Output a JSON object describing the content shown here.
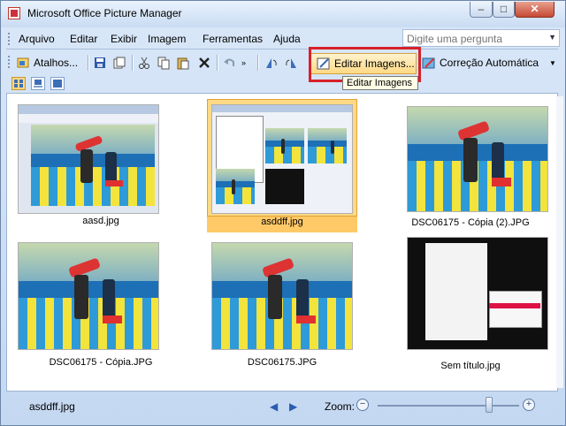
{
  "window": {
    "title": "Microsoft Office Picture Manager"
  },
  "menu": {
    "items": [
      "Arquivo",
      "Editar",
      "Exibir",
      "Imagem",
      "Ferramentas",
      "Ajuda"
    ],
    "help_placeholder": "Digite uma pergunta"
  },
  "toolbar": {
    "shortcuts_label": "Atalhos...",
    "edit_images_label": "Editar Imagens...",
    "auto_correct_label": "Correção Automática",
    "tooltip": "Editar Imagens"
  },
  "thumbnails": [
    {
      "label": "aasd.jpg",
      "kind": "screenshot",
      "selected": false
    },
    {
      "label": "asddff.jpg",
      "kind": "screenshot",
      "selected": true
    },
    {
      "label": "DSC06175 - Cópia (2).JPG",
      "kind": "photo",
      "selected": false
    },
    {
      "label": "DSC06175 - Cópia.JPG",
      "kind": "photo",
      "selected": false
    },
    {
      "label": "DSC06175.JPG",
      "kind": "photo",
      "selected": false
    },
    {
      "label": "Sem título.jpg",
      "kind": "dark-screenshot",
      "selected": false
    }
  ],
  "status": {
    "current_file": "asddff.jpg",
    "zoom_label": "Zoom:",
    "zoom_level": 0.75
  },
  "colors": {
    "highlight_border": "#d8202a",
    "selection": "#ffd985"
  }
}
